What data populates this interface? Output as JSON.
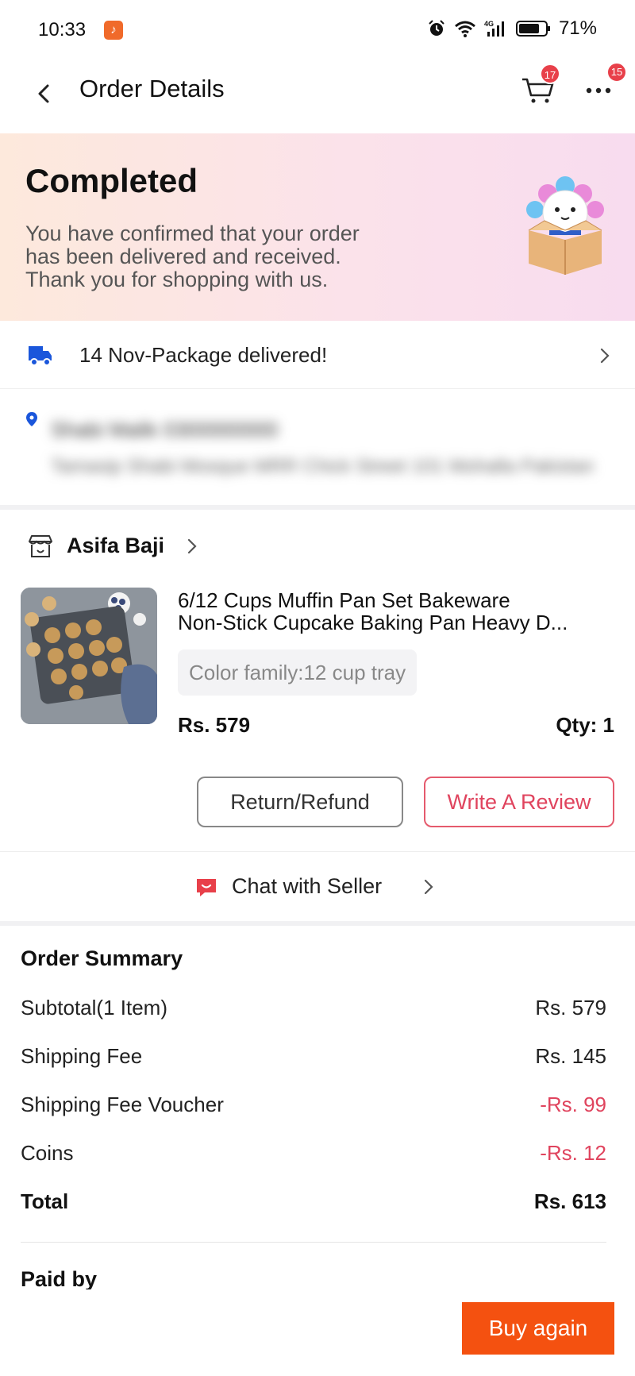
{
  "status_bar": {
    "time": "10:33",
    "battery": "71%",
    "network": "4G"
  },
  "header": {
    "title": "Order Details",
    "cart_badge": "17",
    "more_badge": "15"
  },
  "status_banner": {
    "title": "Completed",
    "message_lines": [
      "You have confirmed that your order",
      "has been delivered and received.",
      "Thank you for shopping with us."
    ]
  },
  "delivery": {
    "text": "14 Nov-Package delivered!"
  },
  "address": {
    "name": "Shabi Malik 0300000000",
    "line": "Tamasip Shabi Mosque MRR Chick Street 101 Mohalla Pakistan"
  },
  "seller": {
    "name": "Asifa Baji"
  },
  "product": {
    "title_line1": "6/12 Cups Muffin Pan Set Bakeware",
    "title_line2": "Non-Stick Cupcake Baking Pan Heavy D...",
    "variant": "Color family:12 cup tray",
    "price": "Rs. 579",
    "qty": "Qty: 1"
  },
  "actions": {
    "return_label": "Return/Refund",
    "review_label": "Write A Review"
  },
  "chat": {
    "label": "Chat with Seller"
  },
  "summary": {
    "title": "Order Summary",
    "rows": [
      {
        "label": "Subtotal(1 Item)",
        "value": "Rs. 579"
      },
      {
        "label": "Shipping Fee",
        "value": "Rs. 145"
      },
      {
        "label": "Shipping Fee Voucher",
        "value": "-Rs. 99"
      },
      {
        "label": "Coins",
        "value": "-Rs. 12"
      },
      {
        "label": "Total",
        "value": "Rs. 613"
      }
    ],
    "paid_by_label": "Paid by"
  },
  "bottom": {
    "buy_again_label": "Buy again"
  },
  "colors": {
    "accent": "#f45110",
    "badge": "#e8404a",
    "negative": "#e0445e",
    "truck": "#1a56db"
  }
}
